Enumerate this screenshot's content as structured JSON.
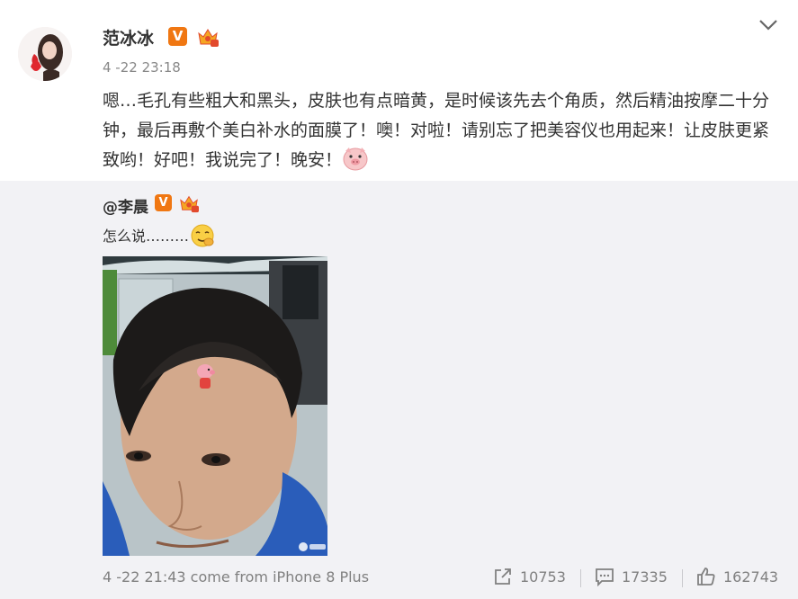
{
  "post": {
    "username": "范冰冰",
    "verified_label": "V",
    "timestamp": "4 -22 23:18",
    "text": "嗯…毛孔有些粗大和黑头，皮肤也有点暗黄，是时候该先去个角质，然后精油按摩二十分钟，最后再敷个美白补水的面膜了！噢！对啦！请别忘了把美容仪也用起来！让皮肤更紧致哟！好吧！我说完了！晚安！",
    "emoji": "pig-emoji-icon"
  },
  "repost": {
    "username": "@李晨",
    "verified_label": "V",
    "text": "怎么说………",
    "emoji": "face-emoji-icon",
    "footer_time": "4 -22 21:43 come from iPhone 8 Plus"
  },
  "actions": {
    "share_count": "10753",
    "comment_count": "17335",
    "like_count": "162743"
  },
  "colors": {
    "verified": "#f07712",
    "repost_bg": "#f2f2f5",
    "meta_text": "#808080"
  }
}
